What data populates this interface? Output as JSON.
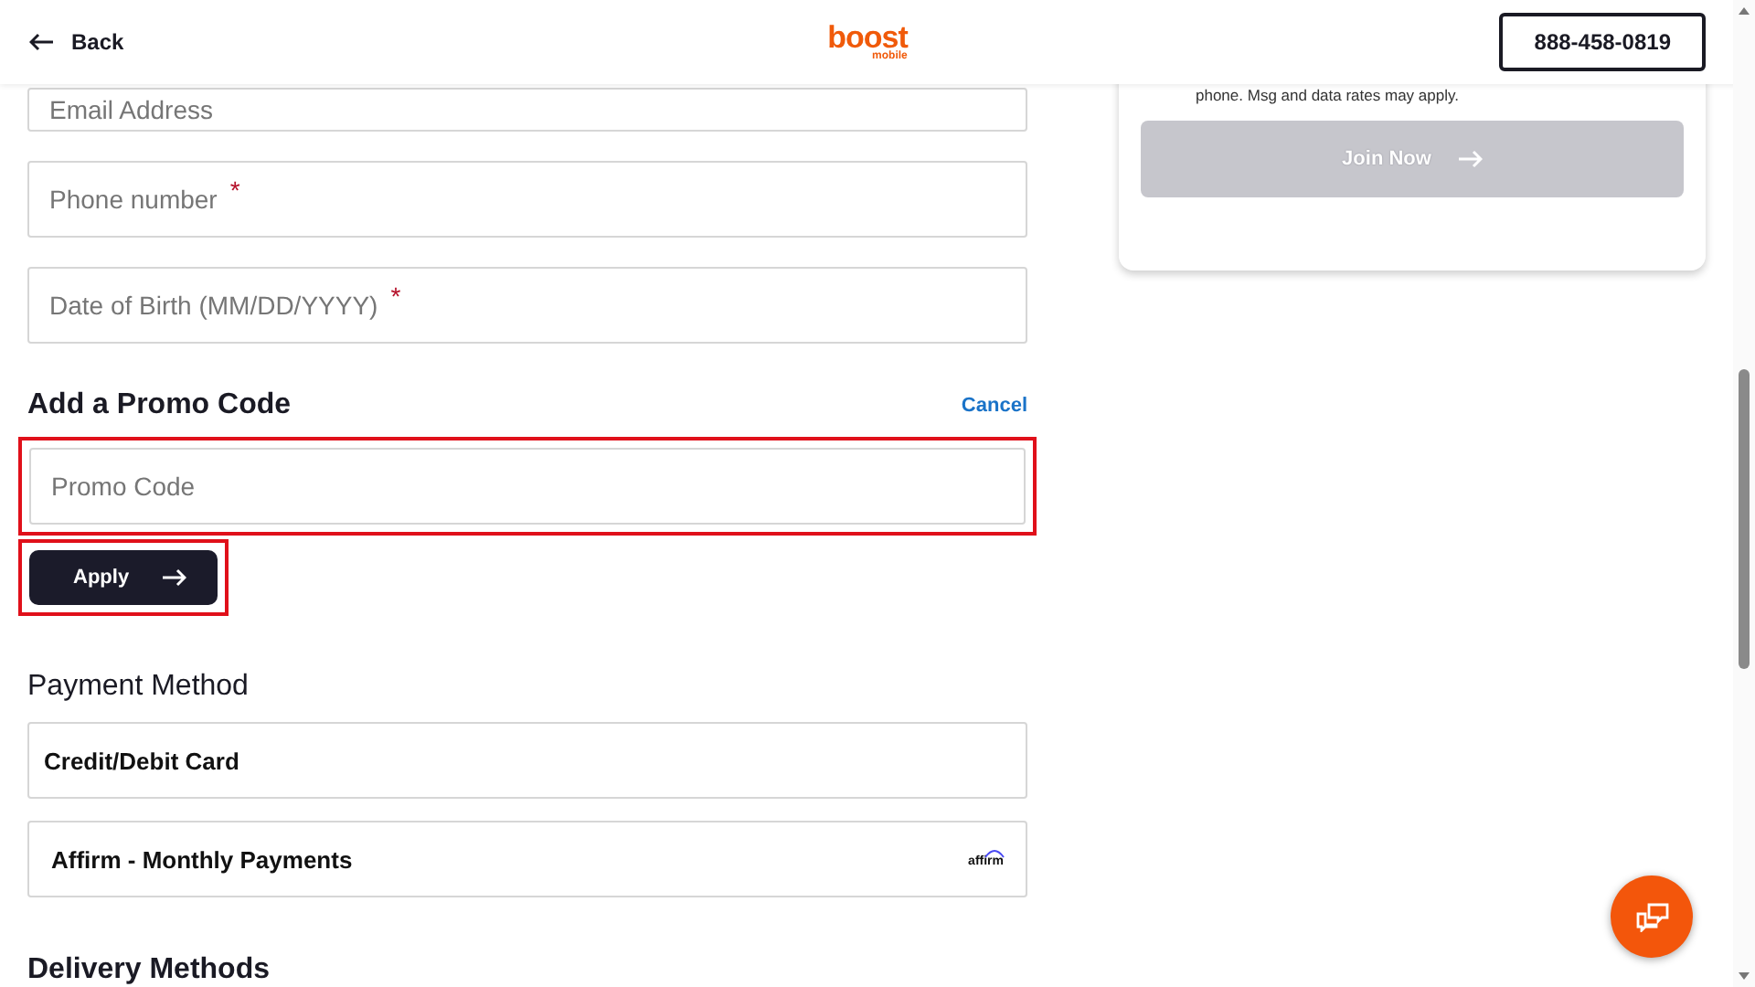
{
  "header": {
    "back_label": "Back",
    "logo_text": "boost",
    "logo_subtext": "mobile",
    "phone_button": "888-458-0819"
  },
  "required_marker": "*",
  "contact_fields": [
    {
      "placeholder": "Email Address",
      "required": false
    },
    {
      "placeholder": "Phone number",
      "required": true
    },
    {
      "placeholder": "Date of Birth (MM/DD/YYYY)",
      "required": true
    }
  ],
  "promo": {
    "heading": "Add a Promo Code",
    "cancel_link": "Cancel",
    "field": {
      "placeholder": "Promo Code"
    },
    "apply_button": "Apply",
    "highlighted": true
  },
  "payment": {
    "heading": "Payment Method",
    "options": [
      {
        "label": "Credit/Debit Card",
        "kind": "card"
      },
      {
        "label": "Affirm - Monthly Payments",
        "kind": "affirm",
        "logo_text": "affirm"
      }
    ]
  },
  "delivery": {
    "heading": "Delivery Methods"
  },
  "join_card": {
    "disclaimer": "phone. Msg and data rates may apply.",
    "button": "Join Now",
    "disabled": true
  }
}
